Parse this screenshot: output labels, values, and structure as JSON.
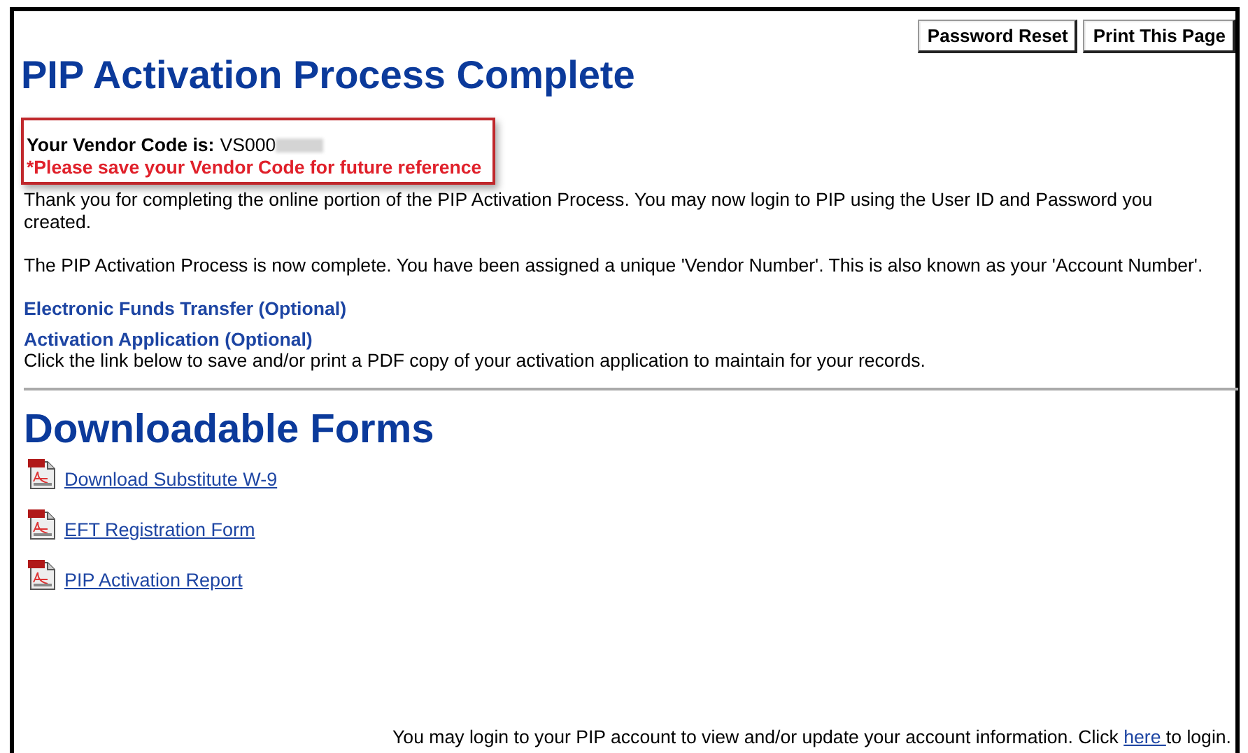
{
  "buttons": [
    "Password Reset",
    "Print This Page"
  ],
  "title": "PIP Activation Process Complete",
  "vendor_box": {
    "label": "Your Vendor Code is:",
    "code": "VS000",
    "redacted": true,
    "notice": "*Please save your Vendor Code for future reference"
  },
  "paragraphs": [
    "Thank you for completing the online portion of the PIP Activation Process. You may now login to PIP using the User ID and Password you created.",
    "The PIP Activation Process is now complete.  You have been assigned a unique 'Vendor Number'.  This is also known as your 'Account Number'."
  ],
  "optional_links": [
    {
      "label": "Electronic Funds Transfer (Optional)"
    },
    {
      "label": "Activation Application (Optional)",
      "note": "Click the link below to save and/or print a PDF copy of your activation application to maintain for your records."
    }
  ],
  "forms_heading": "Downloadable Forms",
  "forms": [
    {
      "label": "Download Substitute W-9"
    },
    {
      "label": "EFT Registration Form"
    },
    {
      "label": "PIP Activation Report"
    }
  ],
  "footer": {
    "before": "You may login to your PIP account to view and/or update your account information. Click ",
    "link": "here ",
    "after": "to login."
  }
}
